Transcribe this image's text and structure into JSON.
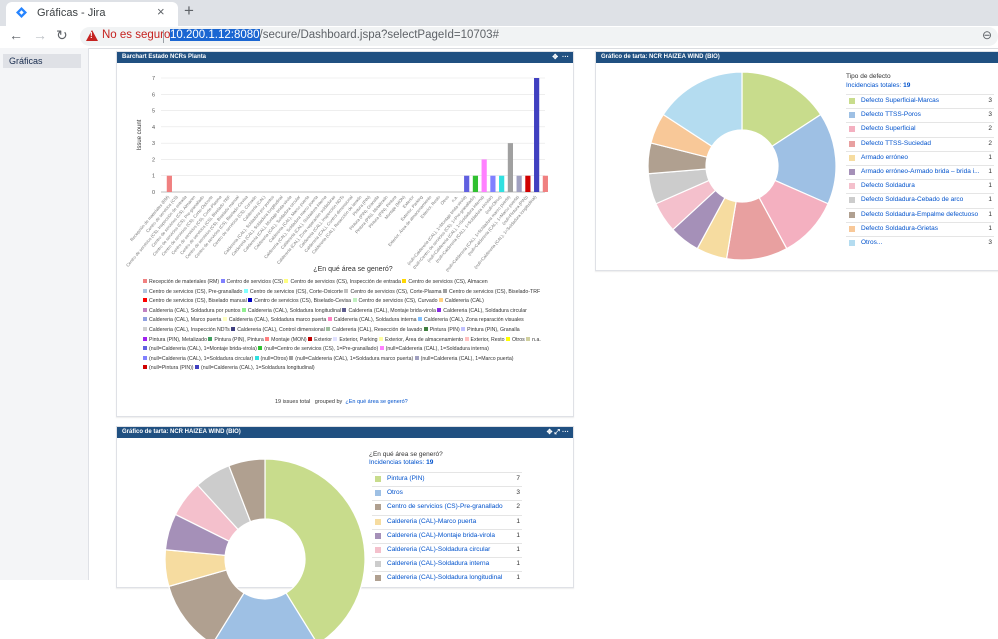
{
  "browser": {
    "tab_title": "Gráficas - Jira",
    "security_label": "No es seguro",
    "url_host": "10.200.1.12:8080",
    "url_path": "/secure/Dashboard.jspa?selectPageId=10703#"
  },
  "sidebar": {
    "items": [
      {
        "label": "Gráficas"
      }
    ]
  },
  "bar_gadget": {
    "title": "Barchart Estado NCRs Planta",
    "xlabel": "¿En qué área se generó?",
    "ylabel": "Issue count",
    "footer_total": "19 issues total",
    "footer_grouped": "grouped by",
    "footer_field": "¿En qué área se generó?"
  },
  "pie_top": {
    "title": "Gráfico de tarta: NCR HAIZEA WIND (BIO)",
    "legend_title": "Tipo de defecto",
    "total_label": "Incidencias totales:",
    "total_value": "19"
  },
  "pie_bottom": {
    "title": "Gráfico de tarta: NCR HAIZEA WIND (BIO)",
    "legend_title": "¿En qué área se generó?",
    "total_label": "Incidencias totales:",
    "total_value": "19"
  },
  "chart_data": [
    {
      "type": "bar",
      "title": "Barchart Estado NCRs Planta",
      "xlabel": "¿En qué área se generó?",
      "ylabel": "Issue count",
      "ylim": [
        0,
        7
      ],
      "yticks": [
        0,
        1,
        2,
        3,
        4,
        5,
        6,
        7
      ],
      "categories": [
        "Recepción de materiales (RM)",
        "Centro de servicios (CS)",
        "Centro de servicios (CS), Inspección de entrada",
        "Centro de servicios (CS), Almacen",
        "Centro de servicios (CS), Pre-granallado",
        "Centro de servicios (CS), Corte-Oxicorte",
        "Centro de servicios (CS), Corte-Plasma",
        "Centro de servicios (CS), Biselado-TRF",
        "Centro de servicios (CS), Biselado manual",
        "Centro de servicios (CS), Biselado-Cevisa",
        "Centro de servicios (CS), Curvado",
        "Caldereria (CAL)",
        "Caldereria (CAL), Soldadura por puntos",
        "Caldereria (CAL), Soldadura longitudinal",
        "Caldereria (CAL), Montaje brida-virola",
        "Caldereria (CAL), Soldadura circular",
        "Caldereria (CAL), Marco puerta",
        "Caldereria (CAL), Soldadura marco puerta",
        "Caldereria (CAL), Soldadura interna",
        "Caldereria (CAL), Zona reparación soldaduras",
        "Caldereria (CAL), Inspección NDTs",
        "Caldereria (CAL), Control dimensional",
        "Caldereria (CAL), Resección de lavado",
        "Pintura (PIN)",
        "Pintura (PIN), Granalla",
        "Pintura (PIN), Metalizado",
        "Pintura (PIN), Pintura",
        "Montaje (MON)",
        "Exterior",
        "Exterior, Parking",
        "Exterior, Área de almacenamiento",
        "Exterior, Resto",
        "Otros",
        "n.a.",
        "(null=Caldereria (CAL), 1=Montaje brida-virola)",
        "(null=Centro de servicios (CS), 1=Pre-granallado)",
        "(null=Caldereria (CAL), 1=Soldadura interna)",
        "(null=Caldereria (CAL), 1=Soldadura circular)",
        "(null=Otros)",
        "(null=Caldereria (CAL), 1=Soldadura marco puerta)",
        "(null=Caldereria (CAL), 1=Marco puerta)",
        "(null=Pintura (PIN))",
        "(null=Caldereria (CAL), 1=Soldadura longitudinal)"
      ],
      "values": [
        1,
        0,
        0,
        0,
        0,
        0,
        0,
        0,
        0,
        0,
        0,
        0,
        0,
        0,
        0,
        0,
        0,
        0,
        0,
        0,
        0,
        0,
        0,
        0,
        0,
        0,
        0,
        0,
        0,
        0,
        0,
        0,
        0,
        0,
        1,
        1,
        2,
        1,
        1,
        3,
        1,
        1,
        7,
        1
      ],
      "colors": [
        "#f08080",
        "#8080ff",
        "#ffff80",
        "#ffd700",
        "#b0c4de",
        "#80ffff",
        "#c0c0c0",
        "#a0a0a0",
        "#ff0000",
        "#0000c0",
        "#c0f0c0",
        "#ffd080",
        "#c080c0",
        "#90ee90",
        "#606090",
        "#8a2be2",
        "#90a0e0",
        "#ffffc0",
        "#ff80c0",
        "#80c0ff",
        "#d0d0d0",
        "#404080",
        "#a0c0a0",
        "#408040",
        "#c0c0ff",
        "#a020f0",
        "#40a060",
        "#ff8080",
        "#c00000",
        "#e0e0ff",
        "#ffffa0",
        "#ffc0c0",
        "#ffff00",
        "#d0d0a0",
        "#6060e0",
        "#30c030",
        "#ff80ff",
        "#8080ff",
        "#30e0e0",
        "#a0a0a0",
        "#a0a0c0",
        "#d00000",
        "#4040c0"
      ],
      "legend": [
        "Recepción de materiales (RM)",
        "Centro de servicios (CS)",
        "Centro de servicios (CS), Inspección de entrada",
        "Centro de servicios (CS), Almacen",
        "Centro de servicios (CS), Pre-granallado",
        "Centro de servicios (CS), Corte-Oxicorte",
        "Centro de servicios (CS), Corte-Plasma",
        "Centro de servicios (CS), Biselado-TRF",
        "Centro de servicios (CS), Biselado manual",
        "Centro de servicios (CS), Biselado-Cevisa",
        "Centro de servicios (CS), Curvado",
        "Caldereria (CAL)",
        "Caldereria (CAL), Soldadura por puntos",
        "Caldereria (CAL), Soldadura longitudinal",
        "Caldereria (CAL), Montaje brida-virola",
        "Caldereria (CAL), Soldadura circular",
        "Caldereria (CAL), Marco puerta",
        "Caldereria (CAL), Soldadura marco puerta",
        "Caldereria (CAL), Soldadura interna",
        "Caldereria (CAL), Zona reparación visuales",
        "Caldereria (CAL), Inspección NDTs",
        "Caldereria (CAL), Control dimensional",
        "Caldereria (CAL), Resección de lavado",
        "Pintura (PIN)",
        "Pintura (PIN), Granalla",
        "Pintura (PIN), Metalizado",
        "Pintura (PIN), Pintura",
        "Montaje (MON)",
        "Exterior",
        "Exterior, Parking",
        "Exterior, Área de almacenamiento",
        "Exterior, Resto",
        "Otros",
        "n.a.",
        "(null=Caldereria (CAL), 1=Montaje brida-virola)",
        "(null=Centro de servicios (CS), 1=Pre-granallado)",
        "(null=Caldereria (CAL), 1=Soldadura interna)",
        "(null=Caldereria (CAL), 1=Soldadura circular)",
        "(null=Otros)",
        "(null=Caldereria (CAL), 1=Soldadura marco puerta)",
        "(null=Caldereria (CAL), 1=Marco puerta)",
        "(null=Pintura (PIN))",
        "(null=Caldereria (CAL), 1=Soldadura longitudinal)"
      ]
    },
    {
      "type": "pie",
      "title": "Gráfico de tarta: NCR HAIZEA WIND (BIO)",
      "legend_title": "Tipo de defecto",
      "categories": [
        "Defecto Superficial-Marcas",
        "Defecto TTSS-Poros",
        "Defecto Superficial",
        "Defecto TTSS-Suciedad",
        "Armado erróneo",
        "Armado erróneo-Armado brida – brida i...",
        "Defecto Soldadura",
        "Defecto Soldadura-Cebado de arco",
        "Defecto Soldadura-Empalme defectuoso",
        "Defecto Soldadura-Grietas",
        "Otros..."
      ],
      "values": [
        3,
        3,
        2,
        2,
        1,
        1,
        1,
        1,
        1,
        1,
        3
      ],
      "colors": [
        "#c8dc8c",
        "#9ec0e4",
        "#f4b0c0",
        "#e8a0a0",
        "#f6dca0",
        "#a590b8",
        "#f4c0cc",
        "#cccccc",
        "#b0a090",
        "#f8c898",
        "#b4dcf0"
      ]
    },
    {
      "type": "pie",
      "title": "Gráfico de tarta: NCR HAIZEA WIND (BIO)",
      "legend_title": "¿En qué área se generó?",
      "categories": [
        "Pintura (PIN)",
        "Otros",
        "Centro de servicios (CS)-Pre-granallado",
        "Caldereria (CAL)-Marco puerta",
        "Caldereria (CAL)-Montaje brida-virola",
        "Caldereria (CAL)-Soldadura circular",
        "Caldereria (CAL)-Soldadura interna",
        "Caldereria (CAL)-Soldadura longitudinal"
      ],
      "values": [
        7,
        3,
        2,
        1,
        1,
        1,
        1,
        1
      ],
      "colors": [
        "#c8dc8c",
        "#9ec0e4",
        "#b0a090",
        "#f6dca0",
        "#a590b8",
        "#f4c0cc",
        "#cccccc",
        "#b0a090"
      ]
    }
  ]
}
